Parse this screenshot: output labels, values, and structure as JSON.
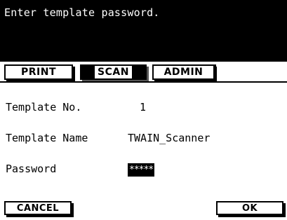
{
  "message": "Enter template password.",
  "tabs": [
    {
      "label": "PRINT"
    },
    {
      "label": "SCAN"
    },
    {
      "label": "ADMIN"
    }
  ],
  "active_tab": "SCAN",
  "fields": {
    "template_no": {
      "label": "Template No.",
      "value": "1"
    },
    "template_name": {
      "label": "Template Name",
      "value": "TWAIN_Scanner"
    },
    "password": {
      "label": "Password",
      "value": "*****"
    }
  },
  "buttons": {
    "cancel": "CANCEL",
    "ok": "OK"
  },
  "colors": {
    "background": "#ffffff",
    "foreground": "#000000"
  }
}
